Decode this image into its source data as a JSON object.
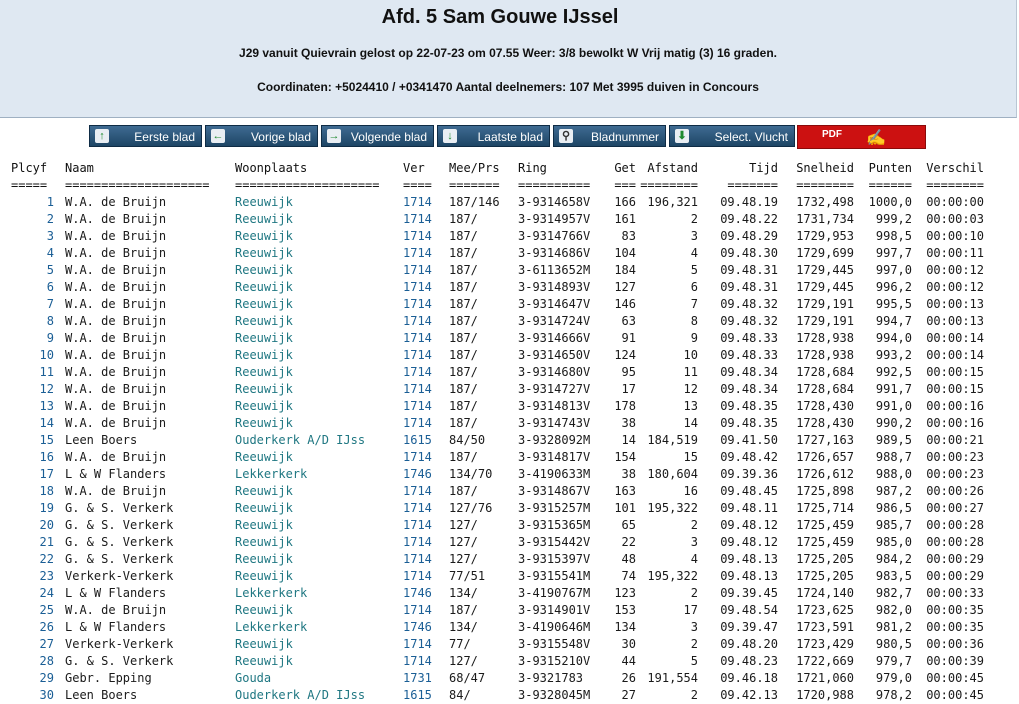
{
  "header": {
    "title": "Afd. 5 Sam Gouwe IJssel",
    "flight_info": "J29 vanuit Quievrain gelost op 22-07-23 om 07.55 Weer: 3/8 bewolkt W Vrij matig (3) 16 graden.",
    "coords_info": "Coordinaten: +5024410 / +0341470 Aantal deelnemers: 107 Met 3995 duiven in Concours"
  },
  "nav": {
    "first": "Eerste blad",
    "prev": "Vorige blad",
    "next": "Volgende blad",
    "last": "Laatste blad",
    "page_no": "Bladnummer",
    "select": "Select. Vlucht",
    "pdf": "PDF"
  },
  "table": {
    "headers": [
      "Plcyf",
      "Naam",
      "Woonplaats",
      "Ver",
      "Mee/Prs",
      "Ring",
      "Get",
      "Afstand",
      "Tijd",
      "Snelheid",
      "Punten",
      "Verschil"
    ],
    "separators": [
      "=====",
      "====================",
      "====================",
      "====",
      "=======",
      "==========",
      "===",
      "========",
      "=======",
      "========",
      "======",
      "========"
    ],
    "rows": [
      [
        "1",
        "W.A. de Bruijn",
        "Reeuwijk",
        "1714",
        "187/146",
        "3-9314658V",
        "166",
        "196,321",
        "09.48.19",
        "1732,498",
        "1000,0",
        "00:00:00"
      ],
      [
        "2",
        "W.A. de Bruijn",
        "Reeuwijk",
        "1714",
        "187/",
        "3-9314957V",
        "161",
        "2",
        "09.48.22",
        "1731,734",
        "999,2",
        "00:00:03"
      ],
      [
        "3",
        "W.A. de Bruijn",
        "Reeuwijk",
        "1714",
        "187/",
        "3-9314766V",
        "83",
        "3",
        "09.48.29",
        "1729,953",
        "998,5",
        "00:00:10"
      ],
      [
        "4",
        "W.A. de Bruijn",
        "Reeuwijk",
        "1714",
        "187/",
        "3-9314686V",
        "104",
        "4",
        "09.48.30",
        "1729,699",
        "997,7",
        "00:00:11"
      ],
      [
        "5",
        "W.A. de Bruijn",
        "Reeuwijk",
        "1714",
        "187/",
        "3-6113652M",
        "184",
        "5",
        "09.48.31",
        "1729,445",
        "997,0",
        "00:00:12"
      ],
      [
        "6",
        "W.A. de Bruijn",
        "Reeuwijk",
        "1714",
        "187/",
        "3-9314893V",
        "127",
        "6",
        "09.48.31",
        "1729,445",
        "996,2",
        "00:00:12"
      ],
      [
        "7",
        "W.A. de Bruijn",
        "Reeuwijk",
        "1714",
        "187/",
        "3-9314647V",
        "146",
        "7",
        "09.48.32",
        "1729,191",
        "995,5",
        "00:00:13"
      ],
      [
        "8",
        "W.A. de Bruijn",
        "Reeuwijk",
        "1714",
        "187/",
        "3-9314724V",
        "63",
        "8",
        "09.48.32",
        "1729,191",
        "994,7",
        "00:00:13"
      ],
      [
        "9",
        "W.A. de Bruijn",
        "Reeuwijk",
        "1714",
        "187/",
        "3-9314666V",
        "91",
        "9",
        "09.48.33",
        "1728,938",
        "994,0",
        "00:00:14"
      ],
      [
        "10",
        "W.A. de Bruijn",
        "Reeuwijk",
        "1714",
        "187/",
        "3-9314650V",
        "124",
        "10",
        "09.48.33",
        "1728,938",
        "993,2",
        "00:00:14"
      ],
      [
        "11",
        "W.A. de Bruijn",
        "Reeuwijk",
        "1714",
        "187/",
        "3-9314680V",
        "95",
        "11",
        "09.48.34",
        "1728,684",
        "992,5",
        "00:00:15"
      ],
      [
        "12",
        "W.A. de Bruijn",
        "Reeuwijk",
        "1714",
        "187/",
        "3-9314727V",
        "17",
        "12",
        "09.48.34",
        "1728,684",
        "991,7",
        "00:00:15"
      ],
      [
        "13",
        "W.A. de Bruijn",
        "Reeuwijk",
        "1714",
        "187/",
        "3-9314813V",
        "178",
        "13",
        "09.48.35",
        "1728,430",
        "991,0",
        "00:00:16"
      ],
      [
        "14",
        "W.A. de Bruijn",
        "Reeuwijk",
        "1714",
        "187/",
        "3-9314743V",
        "38",
        "14",
        "09.48.35",
        "1728,430",
        "990,2",
        "00:00:16"
      ],
      [
        "15",
        "Leen Boers",
        "Ouderkerk A/D IJss",
        "1615",
        "84/50",
        "3-9328092M",
        "14",
        "184,519",
        "09.41.50",
        "1727,163",
        "989,5",
        "00:00:21"
      ],
      [
        "16",
        "W.A. de Bruijn",
        "Reeuwijk",
        "1714",
        "187/",
        "3-9314817V",
        "154",
        "15",
        "09.48.42",
        "1726,657",
        "988,7",
        "00:00:23"
      ],
      [
        "17",
        "L & W Flanders",
        "Lekkerkerk",
        "1746",
        "134/70",
        "3-4190633M",
        "38",
        "180,604",
        "09.39.36",
        "1726,612",
        "988,0",
        "00:00:23"
      ],
      [
        "18",
        "W.A. de Bruijn",
        "Reeuwijk",
        "1714",
        "187/",
        "3-9314867V",
        "163",
        "16",
        "09.48.45",
        "1725,898",
        "987,2",
        "00:00:26"
      ],
      [
        "19",
        "G. & S. Verkerk",
        "Reeuwijk",
        "1714",
        "127/76",
        "3-9315257M",
        "101",
        "195,322",
        "09.48.11",
        "1725,714",
        "986,5",
        "00:00:27"
      ],
      [
        "20",
        "G. & S. Verkerk",
        "Reeuwijk",
        "1714",
        "127/",
        "3-9315365M",
        "65",
        "2",
        "09.48.12",
        "1725,459",
        "985,7",
        "00:00:28"
      ],
      [
        "21",
        "G. & S. Verkerk",
        "Reeuwijk",
        "1714",
        "127/",
        "3-9315442V",
        "22",
        "3",
        "09.48.12",
        "1725,459",
        "985,0",
        "00:00:28"
      ],
      [
        "22",
        "G. & S. Verkerk",
        "Reeuwijk",
        "1714",
        "127/",
        "3-9315397V",
        "48",
        "4",
        "09.48.13",
        "1725,205",
        "984,2",
        "00:00:29"
      ],
      [
        "23",
        "Verkerk-Verkerk",
        "Reeuwijk",
        "1714",
        "77/51",
        "3-9315541M",
        "74",
        "195,322",
        "09.48.13",
        "1725,205",
        "983,5",
        "00:00:29"
      ],
      [
        "24",
        "L & W Flanders",
        "Lekkerkerk",
        "1746",
        "134/",
        "3-4190767M",
        "123",
        "2",
        "09.39.45",
        "1724,140",
        "982,7",
        "00:00:33"
      ],
      [
        "25",
        "W.A. de Bruijn",
        "Reeuwijk",
        "1714",
        "187/",
        "3-9314901V",
        "153",
        "17",
        "09.48.54",
        "1723,625",
        "982,0",
        "00:00:35"
      ],
      [
        "26",
        "L & W Flanders",
        "Lekkerkerk",
        "1746",
        "134/",
        "3-4190646M",
        "134",
        "3",
        "09.39.47",
        "1723,591",
        "981,2",
        "00:00:35"
      ],
      [
        "27",
        "Verkerk-Verkerk",
        "Reeuwijk",
        "1714",
        "77/",
        "3-9315548V",
        "30",
        "2",
        "09.48.20",
        "1723,429",
        "980,5",
        "00:00:36"
      ],
      [
        "28",
        "G. & S. Verkerk",
        "Reeuwijk",
        "1714",
        "127/",
        "3-9315210V",
        "44",
        "5",
        "09.48.23",
        "1722,669",
        "979,7",
        "00:00:39"
      ],
      [
        "29",
        "Gebr. Epping",
        "Gouda",
        "1731",
        "68/47",
        "3-9321783",
        "26",
        "191,554",
        "09.46.18",
        "1721,060",
        "979,0",
        "00:00:45"
      ],
      [
        "30",
        "Leen Boers",
        "Ouderkerk A/D IJss",
        "1615",
        "84/",
        "3-9328045M",
        "27",
        "2",
        "09.42.13",
        "1720,988",
        "978,2",
        "00:00:45"
      ]
    ]
  }
}
